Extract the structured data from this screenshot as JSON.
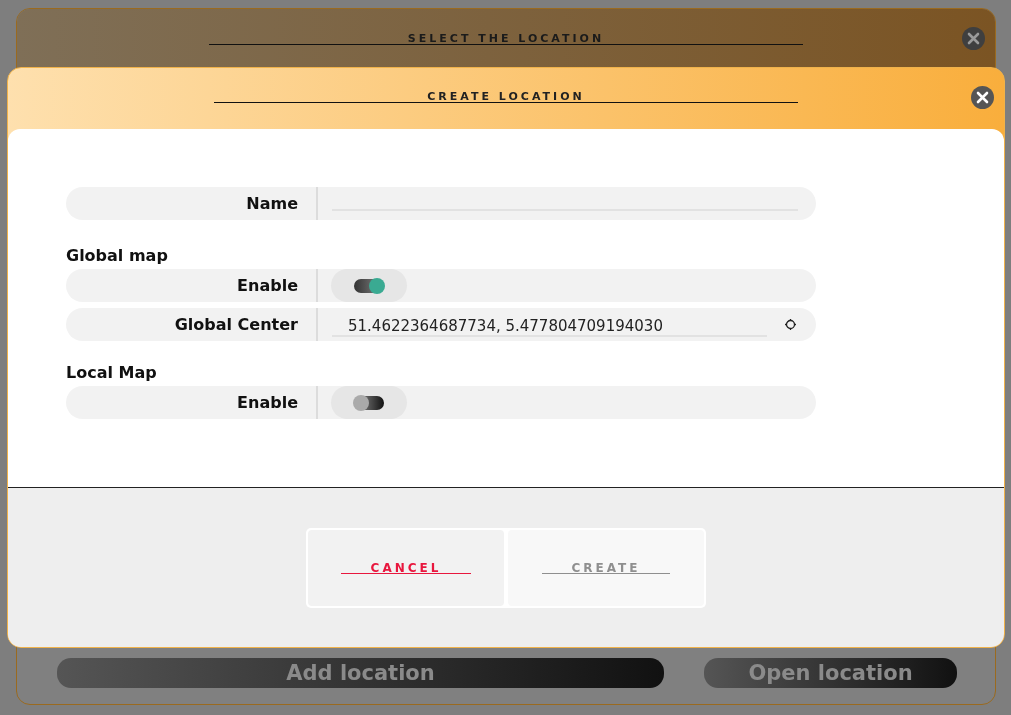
{
  "background_dialog": {
    "title": "SELECT THE LOCATION",
    "buttons": [
      {
        "label": "Add location",
        "kind": "wide"
      },
      {
        "label": "Open location",
        "kind": "narrow"
      }
    ]
  },
  "dialog": {
    "title": "CREATE LOCATION",
    "rows": [
      {
        "kind": "field",
        "label": "Name"
      },
      {
        "kind": "heading",
        "label": "Global map"
      },
      {
        "kind": "toggle",
        "label": "Enable",
        "on": true
      },
      {
        "kind": "location",
        "label": "Global Center",
        "value": "51.4622364687734, 5.477804709194030"
      },
      {
        "kind": "heading",
        "label": "Local Map"
      },
      {
        "kind": "toggle",
        "label": "Enable",
        "on": false
      }
    ],
    "buttons": [
      {
        "label": "CANCEL",
        "kind": "cancel",
        "disabled": false
      },
      {
        "label": "CREATE",
        "kind": "create",
        "disabled": true
      }
    ]
  }
}
